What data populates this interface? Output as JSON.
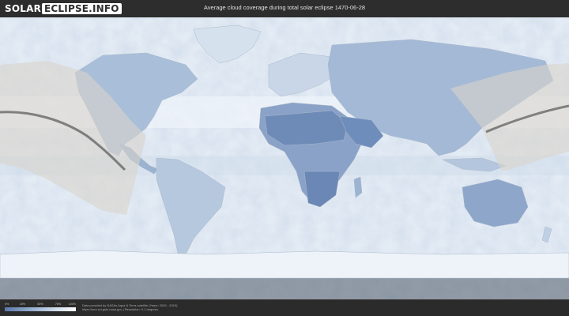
{
  "header": {
    "logo_part1": "SOLAR",
    "logo_part2": "ECLIPSE.INFO",
    "title": "Average cloud coverage during total solar eclipse 1470-06-28"
  },
  "legend": {
    "ticks": [
      {
        "label": "0%",
        "frac": 0.0
      },
      {
        "label": "25%",
        "frac": 0.25
      },
      {
        "label": "50%",
        "frac": 0.5
      },
      {
        "label": "75%",
        "frac": 0.75
      },
      {
        "label": "100%",
        "frac": 1.0
      }
    ]
  },
  "footer": {
    "credit_line1": "Data provided by NASAs Aqua & Terra satellite (Years: 2000 - 2019)",
    "credit_line2": "https://neo.sci.gsfc.nasa.gov | Resolution: 0.1 degrees"
  },
  "colors": {
    "cloud_clear": "#5a78a8",
    "cloud_overcast": "#ffffff",
    "header_bg": "#2d2d2d"
  }
}
